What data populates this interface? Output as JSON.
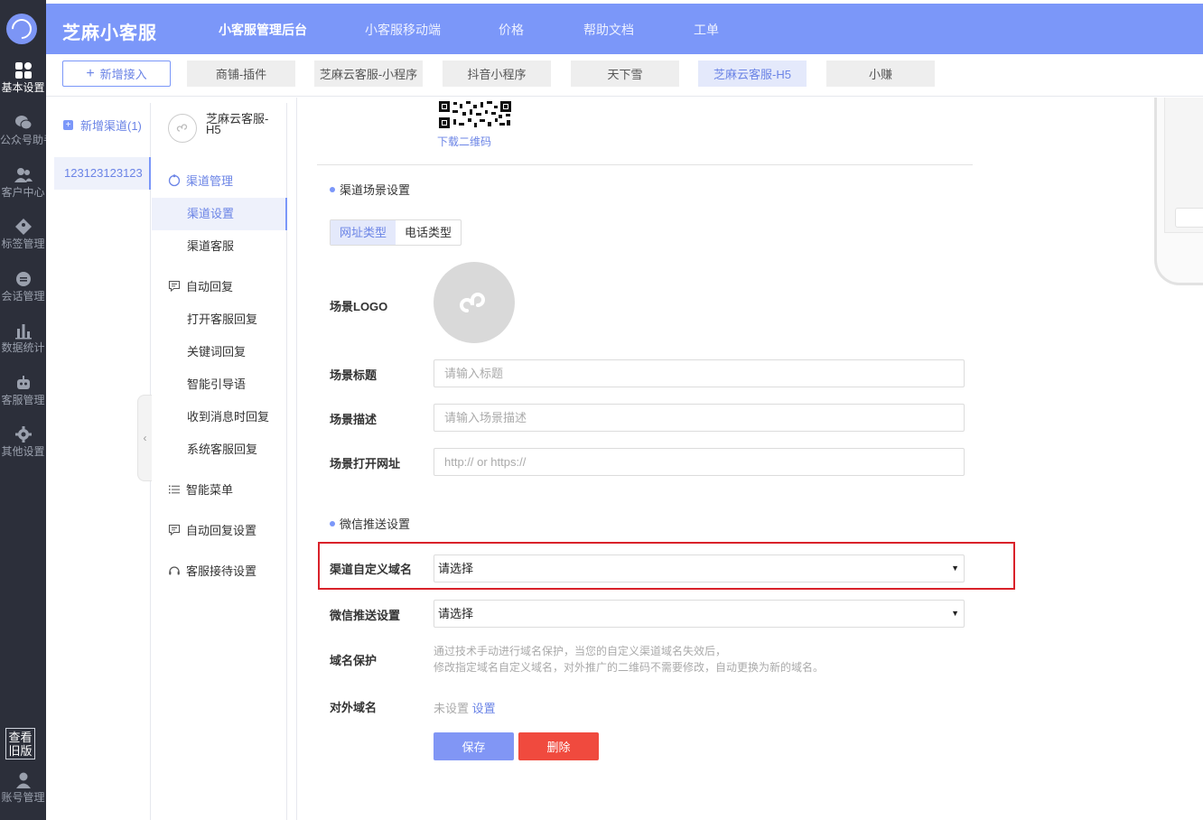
{
  "rail": {
    "items": [
      {
        "label": "基本设置",
        "icon": "grid-icon"
      },
      {
        "label": "公众号助手",
        "icon": "wechat-icon"
      },
      {
        "label": "客户中心",
        "icon": "users-icon"
      },
      {
        "label": "标签管理",
        "icon": "tag-icon"
      },
      {
        "label": "会话管理",
        "icon": "chat-icon"
      },
      {
        "label": "数据统计",
        "icon": "bar-chart-icon"
      },
      {
        "label": "客服管理",
        "icon": "robot-icon"
      },
      {
        "label": "其他设置",
        "icon": "gear-icon"
      }
    ],
    "old_version": "查看旧版",
    "account": "账号管理"
  },
  "header": {
    "brand": "芝麻小客服",
    "nav": [
      "小客服管理后台",
      "小客服移动端",
      "价格",
      "帮助文档",
      "工单"
    ]
  },
  "channel_tabs": {
    "add_label": "新增接入",
    "tabs": [
      "商铺-插件",
      "芝麻云客服-小程序",
      "抖音小程序",
      "天下雪",
      "芝麻云客服-H5",
      "小赚"
    ]
  },
  "channel_list": {
    "new_label": "新增渠道(1)",
    "item": "123123123123"
  },
  "menu": {
    "channel_name": "芝麻云客服-H5",
    "channel_mgmt": "渠道管理",
    "channel_settings": "渠道设置",
    "channel_service": "渠道客服",
    "auto_reply": "自动回复",
    "open_reply": "打开客服回复",
    "keyword_reply": "关键词回复",
    "smart_guide": "智能引导语",
    "receive_reply": "收到消息时回复",
    "system_reply": "系统客服回复",
    "smart_menu": "智能菜单",
    "auto_reply_settings": "自动回复设置",
    "reception_settings": "客服接待设置"
  },
  "form": {
    "download_qr": "下载二维码",
    "scene_section": "渠道场景设置",
    "type_url": "网址类型",
    "type_phone": "电话类型",
    "logo_label": "场景LOGO",
    "title_label": "场景标题",
    "title_placeholder": "请输入标题",
    "desc_label": "场景描述",
    "desc_placeholder": "请输入场景描述",
    "url_label": "场景打开网址",
    "url_placeholder": "http:// or https://",
    "wechat_section": "微信推送设置",
    "domain_label": "渠道自定义域名",
    "domain_value": "请选择",
    "push_label": "微信推送设置",
    "push_value": "请选择",
    "protect_label": "域名保护",
    "protect_help_1": "通过技术手动进行域名保护，当您的自定义渠道域名失效后，",
    "protect_help_2": "修改指定域名自定义域名，对外推广的二维码不需要修改，自动更换为新的域名。",
    "external_label": "对外域名",
    "external_value": "未设置",
    "external_link": "设置",
    "save": "保存",
    "delete": "删除"
  }
}
